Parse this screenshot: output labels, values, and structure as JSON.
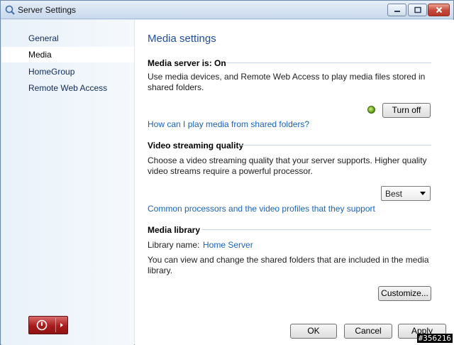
{
  "window": {
    "title": "Server Settings"
  },
  "sidebar": {
    "items": [
      {
        "label": "General",
        "selected": false
      },
      {
        "label": "Media",
        "selected": true
      },
      {
        "label": "HomeGroup",
        "selected": false
      },
      {
        "label": "Remote Web Access",
        "selected": false
      }
    ]
  },
  "content": {
    "page_title": "Media settings",
    "media_server": {
      "heading": "Media server is: On",
      "description": "Use media devices, and Remote Web Access to play media files stored in shared folders.",
      "status": "on",
      "status_color": "#5fa11a",
      "action_button": "Turn off",
      "help_link": "How can I play media from shared folders?"
    },
    "video_streaming": {
      "heading": "Video streaming quality",
      "description": "Choose a video streaming quality that your server supports. Higher quality video streams require a powerful processor.",
      "quality_selected": "Best",
      "help_link": "Common processors and the video profiles that they support"
    },
    "media_library": {
      "heading": "Media library",
      "name_label": "Library name:",
      "name_value": "Home Server",
      "description": "You can view and change the shared folders that are included in the media library.",
      "customize_button": "Customize..."
    }
  },
  "footer": {
    "ok_label": "OK",
    "cancel_label": "Cancel",
    "apply_label": "Apply"
  },
  "watermark": "#356216",
  "colors": {
    "accent_link": "#1a63b9",
    "title_blue": "#1f4e9c",
    "power_button": "#a81c1c"
  }
}
